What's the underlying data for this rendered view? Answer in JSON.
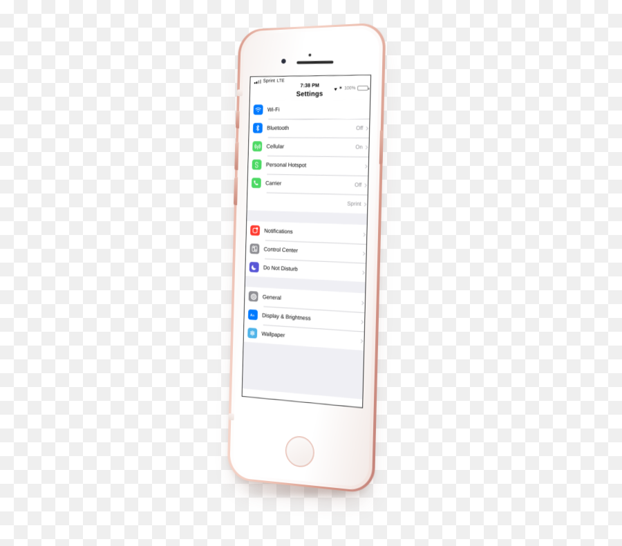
{
  "device": {
    "name": "iPhone",
    "finish": "Rose Gold",
    "body_color": "#e9b7a9",
    "home_button": "home-button"
  },
  "status_bar": {
    "carrier": "Sprint",
    "network_type": "LTE",
    "time": "7:38 PM",
    "battery_percent": "100%",
    "battery_color": "#4cd964",
    "bluetooth_glyph": "✶",
    "location_icon": "location-arrow-icon",
    "signal_icon": "signal-strength-icon"
  },
  "nav": {
    "title": "Settings"
  },
  "groups": [
    {
      "id": "connectivity",
      "rows": [
        {
          "label": "Wi-Fi",
          "value": "",
          "icon": "wifi-icon",
          "color": "#007aff",
          "chevron": false
        },
        {
          "label": "Bluetooth",
          "value": "Off",
          "icon": "bluetooth-icon",
          "color": "#007aff",
          "chevron": true
        },
        {
          "label": "Cellular",
          "value": "On",
          "icon": "cellular-icon",
          "color": "#4cd964",
          "chevron": true
        },
        {
          "label": "Personal Hotspot",
          "value": "",
          "icon": "personal-hotspot-icon",
          "color": "#4cd964",
          "chevron": true
        },
        {
          "label": "Carrier",
          "value": "Off",
          "icon": "phone-icon",
          "color": "#4cd964",
          "chevron": true
        },
        {
          "label": "",
          "value": "Sprint",
          "icon": "",
          "color": "",
          "chevron": true
        }
      ]
    },
    {
      "id": "alerts",
      "rows": [
        {
          "label": "Notifications",
          "value": "",
          "icon": "notifications-icon",
          "color": "#ff3b30",
          "chevron": true
        },
        {
          "label": "Control Center",
          "value": "",
          "icon": "control-center-icon",
          "color": "#8e8e93",
          "chevron": true
        },
        {
          "label": "Do Not Disturb",
          "value": "",
          "icon": "do-not-disturb-icon",
          "color": "#5856d6",
          "chevron": true
        }
      ]
    },
    {
      "id": "system",
      "rows": [
        {
          "label": "General",
          "value": "",
          "icon": "gear-icon",
          "color": "#8e8e93",
          "chevron": true
        },
        {
          "label": "Display & Brightness",
          "value": "",
          "icon": "display-icon",
          "color": "#007aff",
          "chevron": true
        },
        {
          "label": "Wallpaper",
          "value": "",
          "icon": "wallpaper-icon",
          "color": "#4fb3e8",
          "chevron": true
        }
      ]
    }
  ],
  "hardware": {
    "mute_switch": "mute-switch",
    "volume_up": "volume-up-button",
    "volume_down": "volume-down-button",
    "power": "power-button",
    "earpiece": "earpiece-speaker",
    "front_camera": "front-camera",
    "proximity_sensor": "proximity-sensor"
  }
}
